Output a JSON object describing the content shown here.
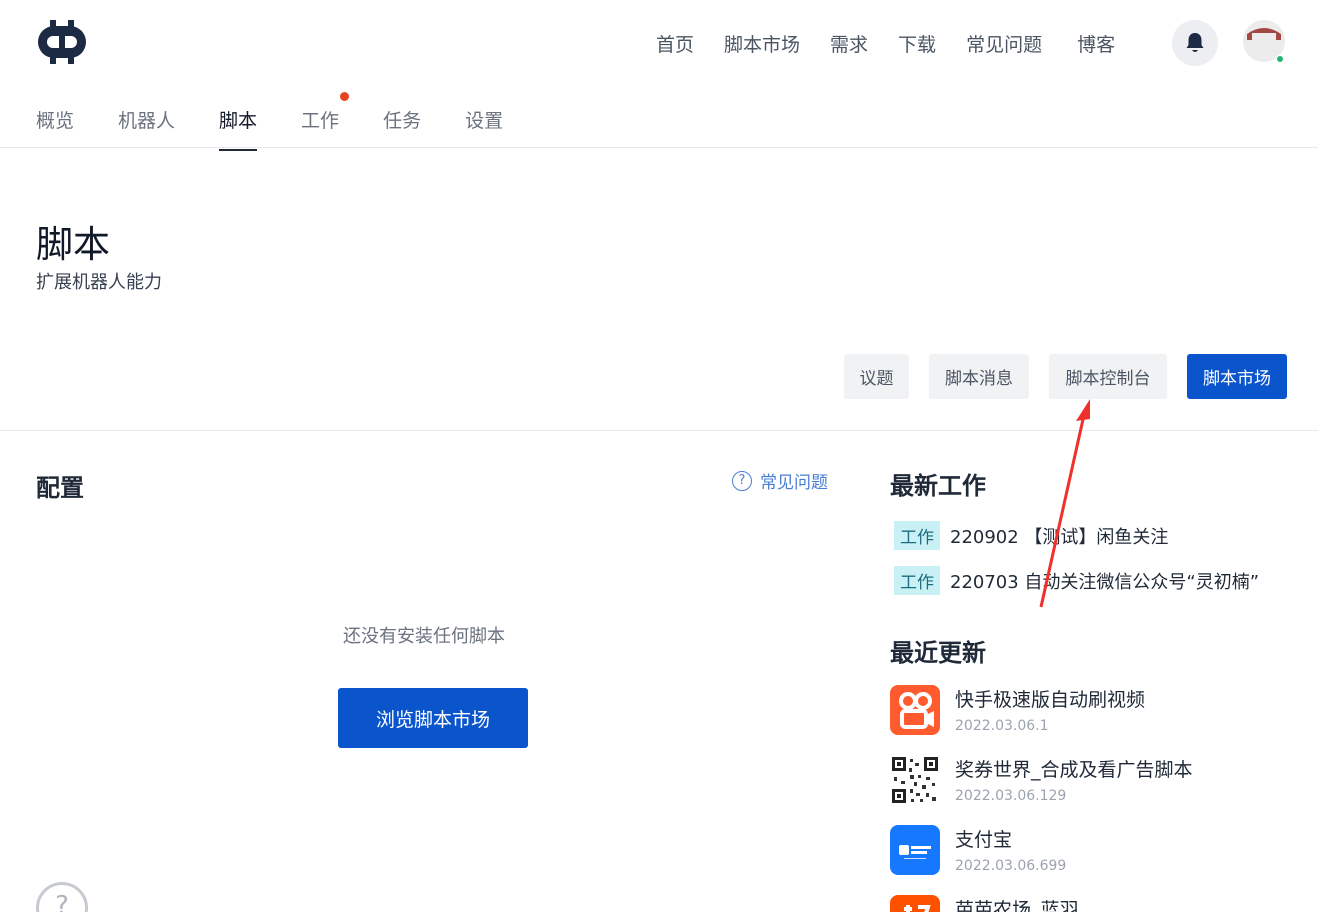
{
  "header": {
    "logo_icon": "robot-logo-icon",
    "nav": [
      "首页",
      "脚本市场",
      "需求",
      "下载",
      "常见问题",
      "博客"
    ],
    "bell_icon": "bell-icon",
    "avatar_status_color": "#22b573"
  },
  "subnav": {
    "tabs": [
      "概览",
      "机器人",
      "脚本",
      "工作",
      "任务",
      "设置"
    ],
    "active": "脚本",
    "notification_on": "工作"
  },
  "page": {
    "title": "脚本",
    "subtitle": "扩展机器人能力"
  },
  "actions": {
    "topics": "议题",
    "messages": "脚本消息",
    "console": "脚本控制台",
    "market": "脚本市场"
  },
  "config": {
    "title": "配置",
    "faq": "常见问题",
    "empty_text": "还没有安装任何脚本",
    "browse_button": "浏览脚本市场",
    "help_icon": "?"
  },
  "latest_jobs": {
    "title": "最新工作",
    "items": [
      {
        "badge": "工作",
        "text": "220902 【测试】闲鱼关注"
      },
      {
        "badge": "工作",
        "text": "220703 自动关注微信公众号“灵初楠”"
      }
    ]
  },
  "recent_updates": {
    "title": "最近更新",
    "items": [
      {
        "name": "快手极速版自动刷视频",
        "version": "2022.03.06.1",
        "icon": "kuaishou-icon"
      },
      {
        "name": "奖券世界_合成及看广告脚本",
        "version": "2022.03.06.129",
        "icon": "qrcode-icon"
      },
      {
        "name": "支付宝",
        "version": "2022.03.06.699",
        "icon": "alipay-icon"
      },
      {
        "name": "芭芭农场_蓝羽",
        "version": "",
        "icon": "taobao-icon"
      }
    ]
  },
  "colors": {
    "primary": "#0b55cc",
    "badge_bg": "#c9f1f5",
    "dot": "#e8431f",
    "annotation_arrow": "#f0302b"
  }
}
